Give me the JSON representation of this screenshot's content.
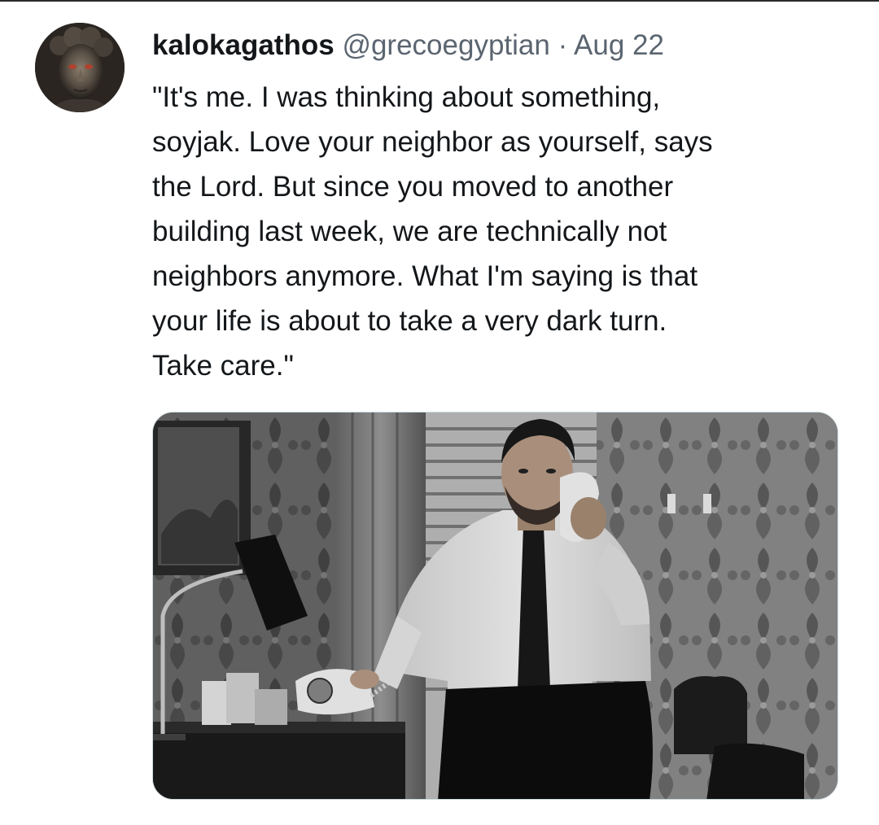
{
  "tweet": {
    "author_name": "kalokagathos",
    "handle": "@grecoegyptian",
    "separator": "·",
    "date": "Aug 22",
    "text": "\"It's me. I was thinking about something,\nsoyjak. Love your neighbor as yourself, says\nthe Lord. But since you moved to another\nbuilding last week, we are technically not\nneighbors anymore. What I'm saying is that\nyour life is about to take a very dark turn.\nTake care.\"",
    "avatar_icon": "bronze-bust-avatar",
    "media_icon": "man-on-telephone-photo"
  },
  "colors": {
    "text": "#14171a",
    "secondary": "#5b6570",
    "border": "#cfd9de"
  }
}
